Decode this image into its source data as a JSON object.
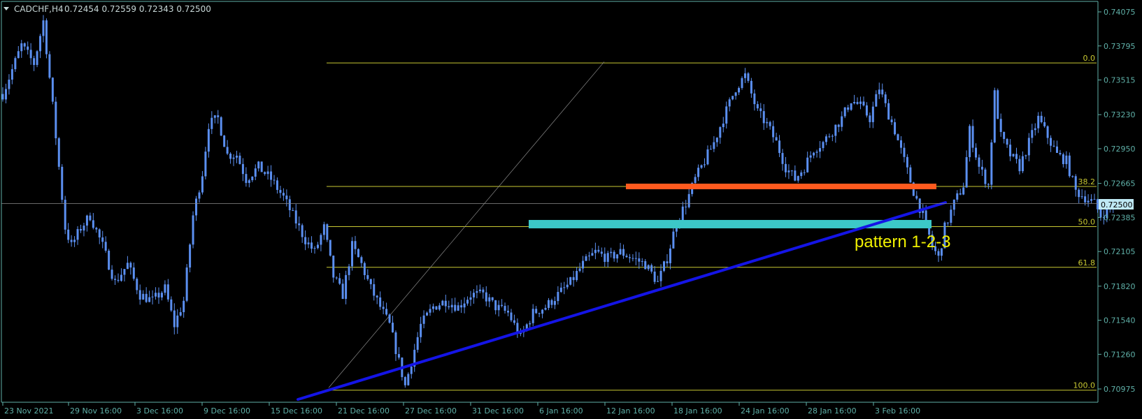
{
  "header": {
    "symbol_timeframe": "CADCHF,H4",
    "ohlc": "0.72454 0.72559 0.72343 0.72500"
  },
  "colors": {
    "background": "#000000",
    "axis": "#5fb0a8",
    "candle": "#5b8ff0",
    "fib": "#c8c832",
    "trendline": "#1414e6",
    "resistance_zone": "#ff5a1e",
    "support_zone": "#3cc8c8",
    "price_line": "#8a8a8a",
    "current_price_bg": "#bfe9f4",
    "pattern_text": "#f0f000"
  },
  "price_axis": {
    "tick_labels": [
      "0.74075",
      "0.73795",
      "0.73515",
      "0.73230",
      "0.72950",
      "0.72665",
      "0.72385",
      "0.72105",
      "0.71820",
      "0.71540",
      "0.71260",
      "0.70975"
    ],
    "current_price": "0.72500"
  },
  "time_axis": {
    "tick_labels": [
      "23 Nov 2021",
      "29 Nov 16:00",
      "3 Dec 16:00",
      "9 Dec 16:00",
      "15 Dec 16:00",
      "21 Dec 16:00",
      "27 Dec 16:00",
      "31 Dec 16:00",
      "6 Jan 16:00",
      "12 Jan 16:00",
      "18 Jan 16:00",
      "24 Jan 16:00",
      "28 Jan 16:00",
      "3 Feb 16:00"
    ]
  },
  "annotations": {
    "pattern_label": "pattern 1-2-3"
  },
  "chart_data": {
    "type": "candlestick",
    "title": "CADCHF,H4",
    "xlabel": "",
    "ylabel": "",
    "ylim": [
      0.70935,
      0.74145
    ],
    "x_ticks": [
      "23 Nov 2021",
      "29 Nov 16:00",
      "3 Dec 16:00",
      "9 Dec 16:00",
      "15 Dec 16:00",
      "21 Dec 16:00",
      "27 Dec 16:00",
      "31 Dec 16:00",
      "6 Jan 16:00",
      "12 Jan 16:00",
      "18 Jan 16:00",
      "24 Jan 16:00",
      "28 Jan 16:00",
      "3 Feb 16:00"
    ],
    "y_ticks": [
      0.74075,
      0.73795,
      0.73515,
      0.7323,
      0.7295,
      0.72665,
      0.72385,
      0.72105,
      0.7182,
      0.7154,
      0.7126,
      0.70975
    ],
    "last_price": 0.725,
    "price_path": [
      [
        0,
        0.734
      ],
      [
        6,
        0.738
      ],
      [
        10,
        0.7365
      ],
      [
        13,
        0.74
      ],
      [
        16,
        0.733
      ],
      [
        18,
        0.728
      ],
      [
        20,
        0.723
      ],
      [
        22,
        0.7215
      ],
      [
        25,
        0.723
      ],
      [
        28,
        0.724
      ],
      [
        32,
        0.7215
      ],
      [
        36,
        0.7185
      ],
      [
        40,
        0.72
      ],
      [
        44,
        0.7175
      ],
      [
        48,
        0.717
      ],
      [
        52,
        0.718
      ],
      [
        55,
        0.715
      ],
      [
        58,
        0.717
      ],
      [
        61,
        0.724
      ],
      [
        64,
        0.7275
      ],
      [
        66,
        0.7315
      ],
      [
        69,
        0.732
      ],
      [
        72,
        0.729
      ],
      [
        75,
        0.729
      ],
      [
        78,
        0.727
      ],
      [
        82,
        0.728
      ],
      [
        86,
        0.727
      ],
      [
        90,
        0.7255
      ],
      [
        94,
        0.7235
      ],
      [
        97,
        0.722
      ],
      [
        100,
        0.721
      ],
      [
        103,
        0.723
      ],
      [
        106,
        0.719
      ],
      [
        109,
        0.7175
      ],
      [
        112,
        0.7215
      ],
      [
        115,
        0.72
      ],
      [
        118,
        0.718
      ],
      [
        121,
        0.7165
      ],
      [
        124,
        0.715
      ],
      [
        127,
        0.712
      ],
      [
        129,
        0.71
      ],
      [
        131,
        0.712
      ],
      [
        134,
        0.715
      ],
      [
        138,
        0.7165
      ],
      [
        142,
        0.717
      ],
      [
        146,
        0.7165
      ],
      [
        150,
        0.7175
      ],
      [
        154,
        0.7175
      ],
      [
        158,
        0.7165
      ],
      [
        162,
        0.716
      ],
      [
        166,
        0.714
      ],
      [
        170,
        0.716
      ],
      [
        174,
        0.7165
      ],
      [
        178,
        0.7175
      ],
      [
        182,
        0.7185
      ],
      [
        186,
        0.72
      ],
      [
        190,
        0.721
      ],
      [
        194,
        0.7205
      ],
      [
        198,
        0.721
      ],
      [
        202,
        0.7205
      ],
      [
        206,
        0.72
      ],
      [
        210,
        0.7185
      ],
      [
        213,
        0.7205
      ],
      [
        216,
        0.7235
      ],
      [
        219,
        0.725
      ],
      [
        222,
        0.727
      ],
      [
        225,
        0.7285
      ],
      [
        228,
        0.73
      ],
      [
        231,
        0.732
      ],
      [
        235,
        0.7345
      ],
      [
        238,
        0.7355
      ],
      [
        240,
        0.734
      ],
      [
        242,
        0.7325
      ],
      [
        245,
        0.7315
      ],
      [
        248,
        0.73
      ],
      [
        251,
        0.728
      ],
      [
        254,
        0.727
      ],
      [
        257,
        0.728
      ],
      [
        260,
        0.7295
      ],
      [
        263,
        0.73
      ],
      [
        266,
        0.731
      ],
      [
        269,
        0.732
      ],
      [
        272,
        0.7335
      ],
      [
        275,
        0.733
      ],
      [
        278,
        0.732
      ],
      [
        281,
        0.7345
      ],
      [
        283,
        0.733
      ],
      [
        286,
        0.731
      ],
      [
        289,
        0.7285
      ],
      [
        292,
        0.726
      ],
      [
        295,
        0.724
      ],
      [
        298,
        0.7215
      ],
      [
        300,
        0.7205
      ],
      [
        302,
        0.723
      ],
      [
        305,
        0.725
      ],
      [
        308,
        0.7265
      ],
      [
        310,
        0.731
      ],
      [
        313,
        0.728
      ],
      [
        316,
        0.7265
      ],
      [
        318,
        0.734
      ],
      [
        320,
        0.7305
      ],
      [
        323,
        0.729
      ],
      [
        326,
        0.728
      ],
      [
        329,
        0.73
      ],
      [
        332,
        0.732
      ],
      [
        335,
        0.7305
      ],
      [
        338,
        0.729
      ],
      [
        341,
        0.7285
      ],
      [
        344,
        0.726
      ],
      [
        347,
        0.7255
      ],
      [
        350,
        0.725
      ],
      [
        352,
        0.724
      ],
      [
        354,
        0.7245
      ],
      [
        356,
        0.725
      ]
    ],
    "fibonacci_levels": [
      {
        "label": "0.0",
        "price": 0.73655
      },
      {
        "label": "38.2",
        "price": 0.7264
      },
      {
        "label": "50.0",
        "price": 0.7231
      },
      {
        "label": "61.8",
        "price": 0.71975
      },
      {
        "label": "100.0",
        "price": 0.70965
      }
    ],
    "fib_swing_line": {
      "from_price": 0.70985,
      "to_price": 0.73665
    },
    "resistance_zone": {
      "price": 0.7264
    },
    "support_zone": {
      "price": 0.7233
    },
    "trendline": {
      "from_price": 0.7095,
      "to_price": 0.7255
    }
  }
}
